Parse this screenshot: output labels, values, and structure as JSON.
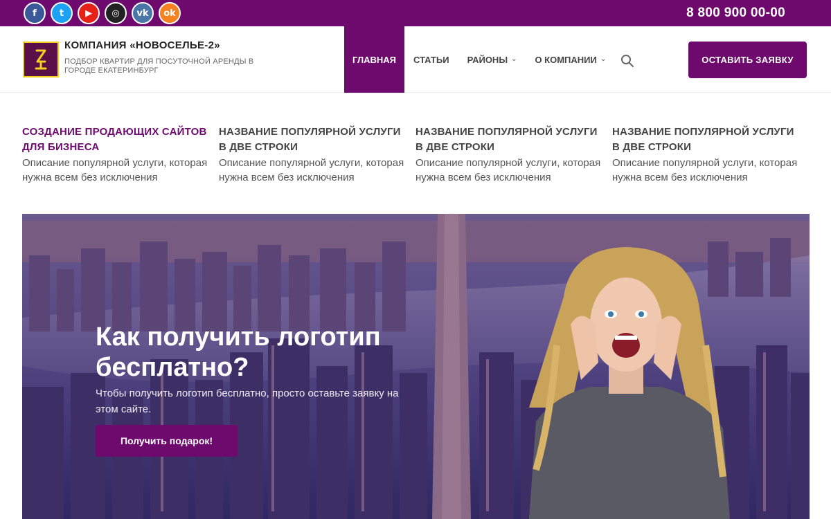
{
  "topbar": {
    "socials": [
      {
        "icon": "facebook-icon",
        "glyph": "f"
      },
      {
        "icon": "twitter-icon",
        "glyph": "t"
      },
      {
        "icon": "youtube-icon",
        "glyph": "▶"
      },
      {
        "icon": "instagram-icon",
        "glyph": "◎"
      },
      {
        "icon": "vk-icon",
        "glyph": "vk"
      },
      {
        "icon": "odnoklassniki-icon",
        "glyph": "ok"
      }
    ],
    "phone": "8 800 900 00-00"
  },
  "header": {
    "logo_icon": "z-logo-icon",
    "company_name": "КОМПАНИЯ «НОВОСЕЛЬЕ-2»",
    "company_sub": "ПОДБОР КВАРТИР ДЛЯ ПОСУТОЧНОЙ АРЕНДЫ В ГОРОДЕ ЕКАТЕРИНБУРГ",
    "nav": {
      "home": "ГЛАВНАЯ",
      "articles": "СТАТЬИ",
      "districts": "РАЙОНЫ",
      "about": "О КОМПАНИИ"
    },
    "search_icon": "search-icon",
    "cta_label": "ОСТАВИТЬ ЗАЯВКУ"
  },
  "services": [
    {
      "title": "СОЗДАНИЕ ПРОДАЮЩИХ САЙТОВ ДЛЯ БИЗНЕСА",
      "desc": "Описание популярной услуги, которая нужна всем без исключения"
    },
    {
      "title": "НАЗВАНИЕ ПОПУЛЯРНОЙ УСЛУГИ В ДВЕ СТРОКИ",
      "desc": "Описание популярной услуги, которая нужна всем без исключения"
    },
    {
      "title": "НАЗВАНИЕ ПОПУЛЯРНОЙ УСЛУГИ В ДВЕ СТРОКИ",
      "desc": "Описание популярной услуги, которая нужна всем без исключения"
    },
    {
      "title": "НАЗВАНИЕ ПОПУЛЯРНОЙ УСЛУГИ В ДВЕ СТРОКИ",
      "desc": "Описание популярной услуги, которая нужна всем без исключения"
    }
  ],
  "hero": {
    "title": "Как получить логотип бесплатно?",
    "text": "Чтобы получить логотип бесплатно, просто оставьте заявку на этом сайте.",
    "button": "Получить подарок!"
  },
  "colors": {
    "brand": "#6e0a6e",
    "logo_accent": "#f3d21d"
  }
}
